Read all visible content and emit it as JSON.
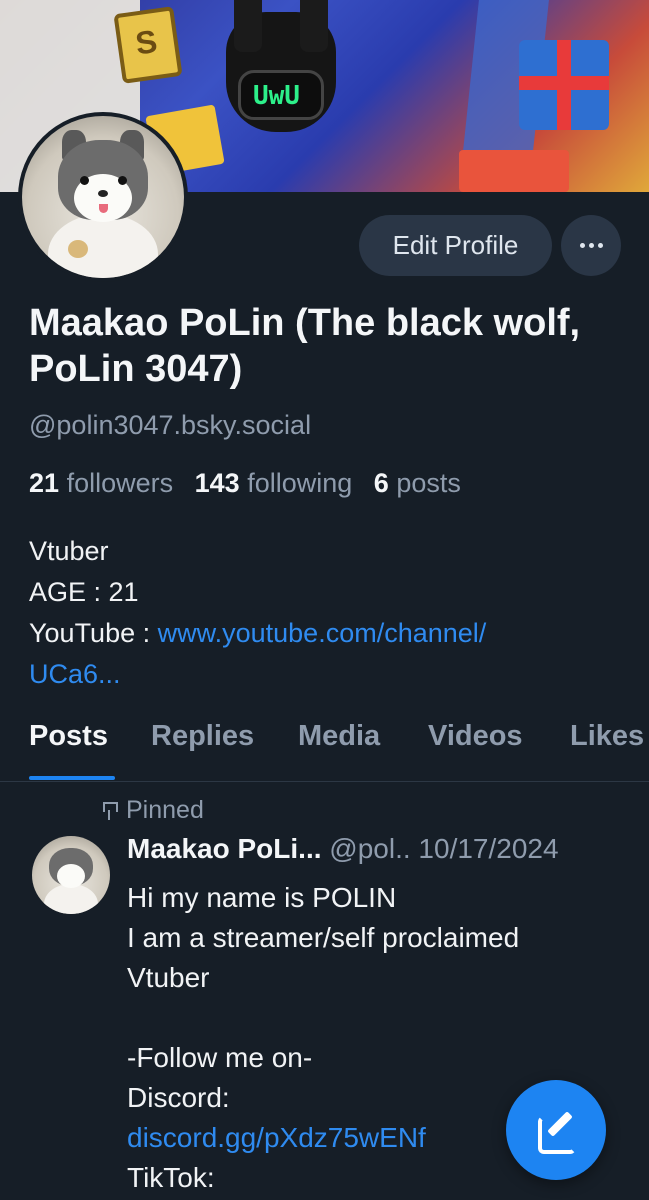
{
  "profile": {
    "edit_label": "Edit Profile",
    "more_icon": "more-icon",
    "display_name": "Maakao PoLin (The black wolf, PoLin 3047)",
    "handle": "@polin3047.bsky.social",
    "stats": {
      "followers_count": "21",
      "followers_label": "followers",
      "following_count": "143",
      "following_label": "following",
      "posts_count": "6",
      "posts_label": "posts"
    },
    "bio": {
      "line1": "Vtuber",
      "line2": "AGE : 21",
      "line3_prefix": "YouTube : ",
      "line3_link": "www.youtube.com/channel/",
      "line4_link": "UCa6..."
    }
  },
  "tabs": [
    {
      "label": "Posts",
      "active": true
    },
    {
      "label": "Replies",
      "active": false
    },
    {
      "label": "Media",
      "active": false
    },
    {
      "label": "Videos",
      "active": false
    },
    {
      "label": "Likes",
      "active": false
    }
  ],
  "post": {
    "pinned_label": "Pinned",
    "author": "Maakao PoLi...",
    "handle": "@pol..",
    "date": "10/17/2024",
    "lines": [
      "Hi my name is POLIN",
      "I am a streamer/self proclaimed",
      "Vtuber",
      "",
      "-Follow me on-",
      "Discord:",
      "discord.gg/pXdz75wENf",
      "TikTok:"
    ]
  },
  "fab": {
    "icon": "compose-icon"
  },
  "colors": {
    "background": "#161e27",
    "accent": "#1d84f2",
    "link": "#2f8bf0",
    "muted": "#8f9cad"
  }
}
